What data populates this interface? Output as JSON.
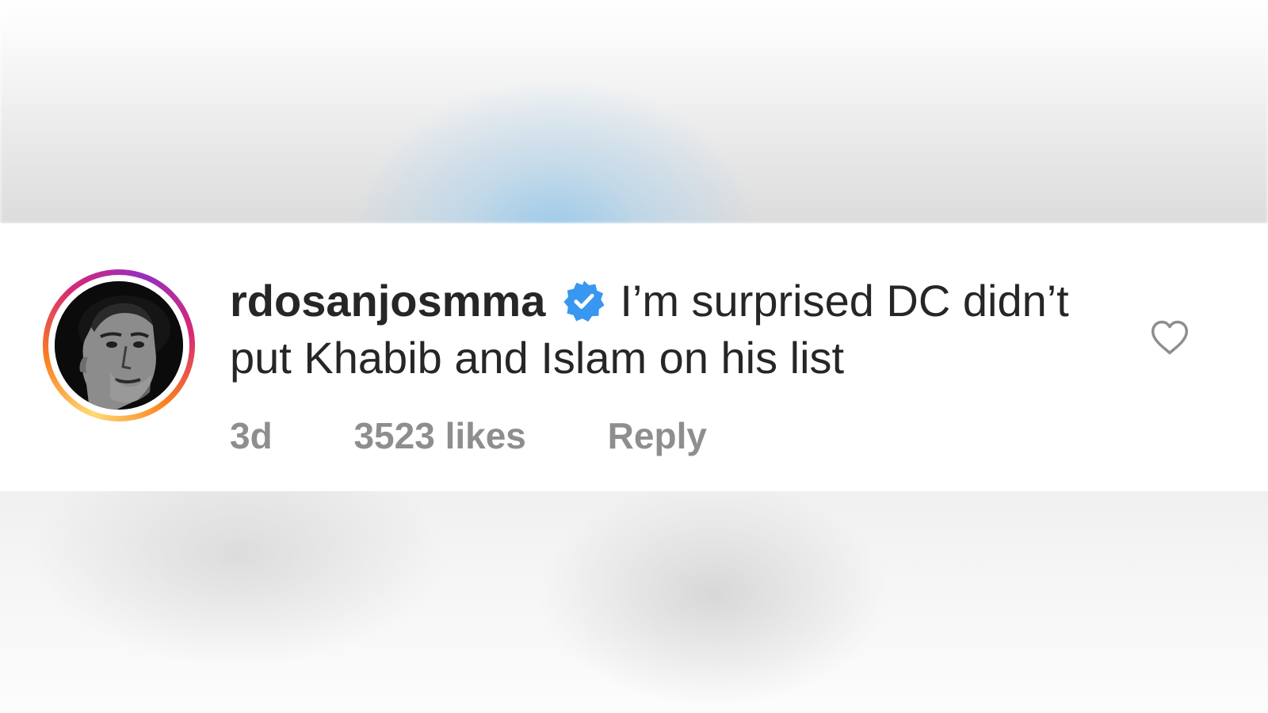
{
  "comment": {
    "username": "rdosanjosmma",
    "verified_icon": "verified-badge-icon",
    "text": "I’m surprised DC didn’t put Khabib and Islam on his list",
    "time": "3d",
    "likes": "3523 likes",
    "reply_label": "Reply",
    "like_icon": "heart-outline-icon",
    "avatar": "profile-photo"
  },
  "colors": {
    "text": "#262626",
    "meta": "#8e8e8e",
    "verified": "#3897f0",
    "background": "#ffffff"
  }
}
